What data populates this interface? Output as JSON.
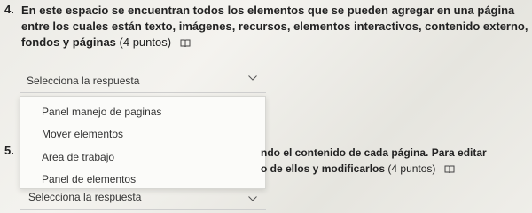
{
  "question4": {
    "number": "4.",
    "text": "En este espacio se encuentran todos los elementos que se pueden agregar en una página entre los cuales están texto, imágenes, recursos, elementos interactivos, contenido externo, fondos y páginas",
    "points": "(4 puntos)",
    "icon": "immersive-reader-icon",
    "select": {
      "value": "Selecciona la respuesta"
    },
    "options": [
      "Panel manejo de paginas",
      "Mover elementos",
      "Area de trabajo",
      "Panel de elementos"
    ]
  },
  "question5": {
    "number": "5.",
    "line1": "ndo el contenido de cada página. Para editar",
    "line2": "o de ellos y modificarlos",
    "points": "(4 puntos)",
    "icon": "immersive-reader-icon",
    "select": {
      "value": "Selecciona la respuesta"
    }
  }
}
